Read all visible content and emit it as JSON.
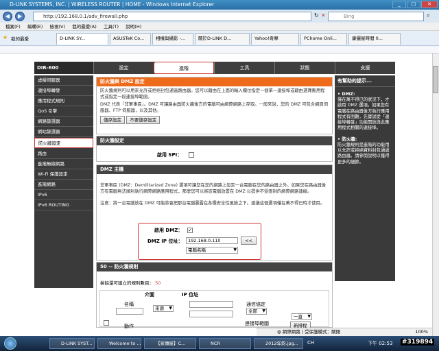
{
  "window": {
    "title": "D-LINK SYSTEMS, INC. | WIRELESS ROUTER | HOME - Windows Internet Explorer",
    "min": "_",
    "max": "□",
    "close": "✕"
  },
  "address": {
    "url": "http://192.168.0.1/adv_firewall.php",
    "search_placeholder": "Bing",
    "refresh": "↻",
    "stop": "✕"
  },
  "menu": [
    "檔案(F)",
    "編輯(E)",
    "檢視(V)",
    "我的最愛(A)",
    "工具(T)",
    "說明(H)"
  ],
  "favorites": {
    "label": "我的最愛",
    "tabs": [
      "D-LINK SY...",
      "ASUSTeK Co...",
      "相機與攝影 -...",
      "關於D-LINK D...",
      "Yahoo!奇摩",
      "PChome Onli...",
      "康儷屋時間 0..."
    ]
  },
  "router": {
    "model": "DIR-600",
    "nav": [
      "設定",
      "進階",
      "工具",
      "狀態",
      "支援"
    ],
    "sidebar": [
      "虛擬伺服器",
      "連接埠轉發",
      "應用程式規則",
      "QoS 引擎",
      "網路篩選器",
      "網站篩選器",
      "防火牆設定",
      "路由",
      "進階無線網路",
      "Wi-Fi 保護設定",
      "進階網路",
      "IPv6",
      "IPv6 ROUTING"
    ],
    "firewall_dmz": {
      "heading": "防火牆與 DMZ 設定",
      "para1": "防火牆規則可以用來允許或拒絕封包通過路由器。您可以藉由在上面的輸入欄位指定一個單一連接埠或藉由選擇應用程式或指定一段連接埠範圍。",
      "para2": "DMZ 代表「非軍事區」。DMZ 可讓路由器防火牆後方的電腦可由網際網路上存取。一般來說，您的 DMZ 可包含網頁伺服器、FTP 伺服器，以及其他。",
      "save_btn": "儲存設定",
      "nosave_btn": "不要儲存設定"
    },
    "firewall_settings": {
      "heading": "防火牆設定",
      "spi_label": "啟用 SPI："
    },
    "dmz_host": {
      "heading": "DMZ 主機",
      "desc": "非軍事區 (DMZ：Demilitarized Zone) 選項可讓您在您的網路上設定一台電腦在您的路由器之外。如果您在路由器後方有電腦無法順利執行網際網路應用程式，那麼您可以將該電腦放置在 DMZ 以提供不受限制的網際網路連線。",
      "note": "注意：將一台電腦放在 DMZ 可能將會把那台電腦暴露在各種安全性風險之下。建議這個選項僅在萬不得已時才使用。",
      "enable_label": "啟用 DMZ：",
      "ip_label": "DMZ IP 位址：",
      "ip_value": "192.168.0.110",
      "copy_btn": "<<",
      "computer_select": "電腦名稱"
    },
    "rules": {
      "heading": "50 -- 防火牆規則",
      "remaining_label": "剩餘還可建立的規則數目：",
      "remaining_value": "50",
      "col_iface": "介面",
      "col_ip": "IP 位址",
      "name_label": "名稱",
      "source_select": "來源",
      "protocol_label": "通信協定",
      "protocol_value": "全部",
      "action_label": "動作",
      "port_range_label": "連接埠範圍",
      "schedule_value": "一直",
      "new_schedule_btn": "新排程"
    },
    "help": {
      "title": "有幫助的提示...",
      "dmz_title": "• DMZ:",
      "dmz_text": "僅在萬不得已的狀況下，才啟用 DMZ 選項。如果您有電腦在路由器後方執行應用程式有困難，先嘗試從「連接埠轉發」功能開放與此應用程式相關的連接埠。",
      "fw_title": "• 防火牆:",
      "fw_text": "防火牆規則是進階的功能用以允許或拒絕資料封包通過路由器。請參閱說明以獲得更多的細節。"
    }
  },
  "statusbar": {
    "zone": "網際網路 | 受保護模式：關閉",
    "zoom": "100%"
  },
  "taskbar": {
    "items": [
      "D-LINK SYST...",
      "Welcome to ...",
      "【家傳屋】C...",
      "NCR",
      "2012年鈞.jpg..."
    ],
    "lang": "CH",
    "clock": "下午 02:53",
    "watermark": "#319894"
  }
}
